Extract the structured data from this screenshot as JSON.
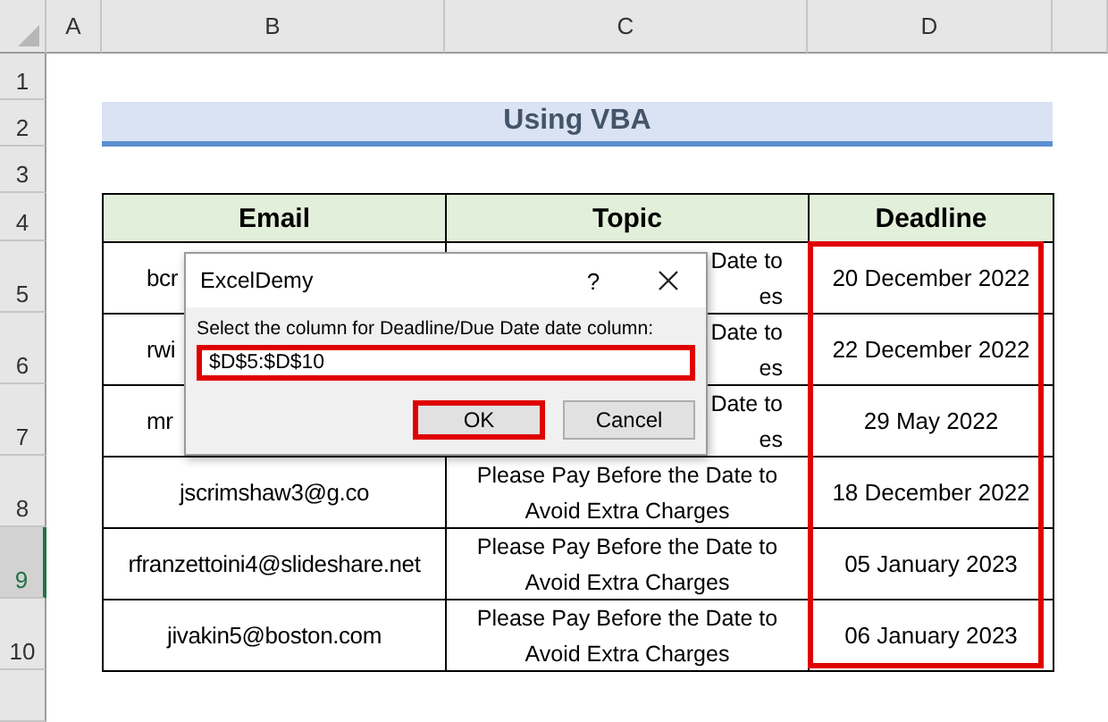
{
  "column_headers": [
    {
      "label": "A",
      "selected": false
    },
    {
      "label": "B",
      "selected": false
    },
    {
      "label": "C",
      "selected": false
    },
    {
      "label": "D",
      "selected": false
    }
  ],
  "row_headers": [
    {
      "label": "1",
      "selected": false
    },
    {
      "label": "2",
      "selected": false
    },
    {
      "label": "3",
      "selected": false
    },
    {
      "label": "4",
      "selected": false
    },
    {
      "label": "5",
      "selected": false
    },
    {
      "label": "6",
      "selected": false
    },
    {
      "label": "7",
      "selected": false
    },
    {
      "label": "8",
      "selected": false
    },
    {
      "label": "9",
      "selected": true
    },
    {
      "label": "10",
      "selected": false
    }
  ],
  "title": "Using VBA",
  "table": {
    "columns": [
      "Email",
      "Topic",
      "Deadline"
    ],
    "deadline_highlighted": true,
    "rows": [
      {
        "email": "bcr",
        "topic_lines": [
          "Date to",
          "es"
        ],
        "deadline": "20 December 2022",
        "obscured": true
      },
      {
        "email": "rwi",
        "topic_lines": [
          "Date to",
          "es"
        ],
        "deadline": "22 December 2022",
        "obscured": true
      },
      {
        "email": "mr",
        "topic_lines": [
          "Date to",
          "es"
        ],
        "deadline": "29 May 2022",
        "obscured": true
      },
      {
        "email": "jscrimshaw3@g.co",
        "topic_lines": [
          "Please Pay Before the Date to",
          "Avoid Extra Charges"
        ],
        "deadline": "18 December 2022",
        "obscured": false
      },
      {
        "email": "rfranzettoini4@slideshare.net",
        "topic_lines": [
          "Please Pay Before the Date to",
          "Avoid Extra Charges"
        ],
        "deadline": "05 January 2023",
        "obscured": false
      },
      {
        "email": "jivakin5@boston.com",
        "topic_lines": [
          "Please Pay Before the Date to",
          "Avoid Extra Charges"
        ],
        "deadline": "06 January 2023",
        "obscured": false
      }
    ]
  },
  "dialog": {
    "title": "ExcelDemy",
    "help": "?",
    "prompt": "Select the column for Deadline/Due Date date column:",
    "value": "$D$5:$D$10",
    "input_highlighted": true,
    "buttons": [
      {
        "label": "OK",
        "highlighted": true
      },
      {
        "label": "Cancel",
        "highlighted": false
      }
    ]
  }
}
